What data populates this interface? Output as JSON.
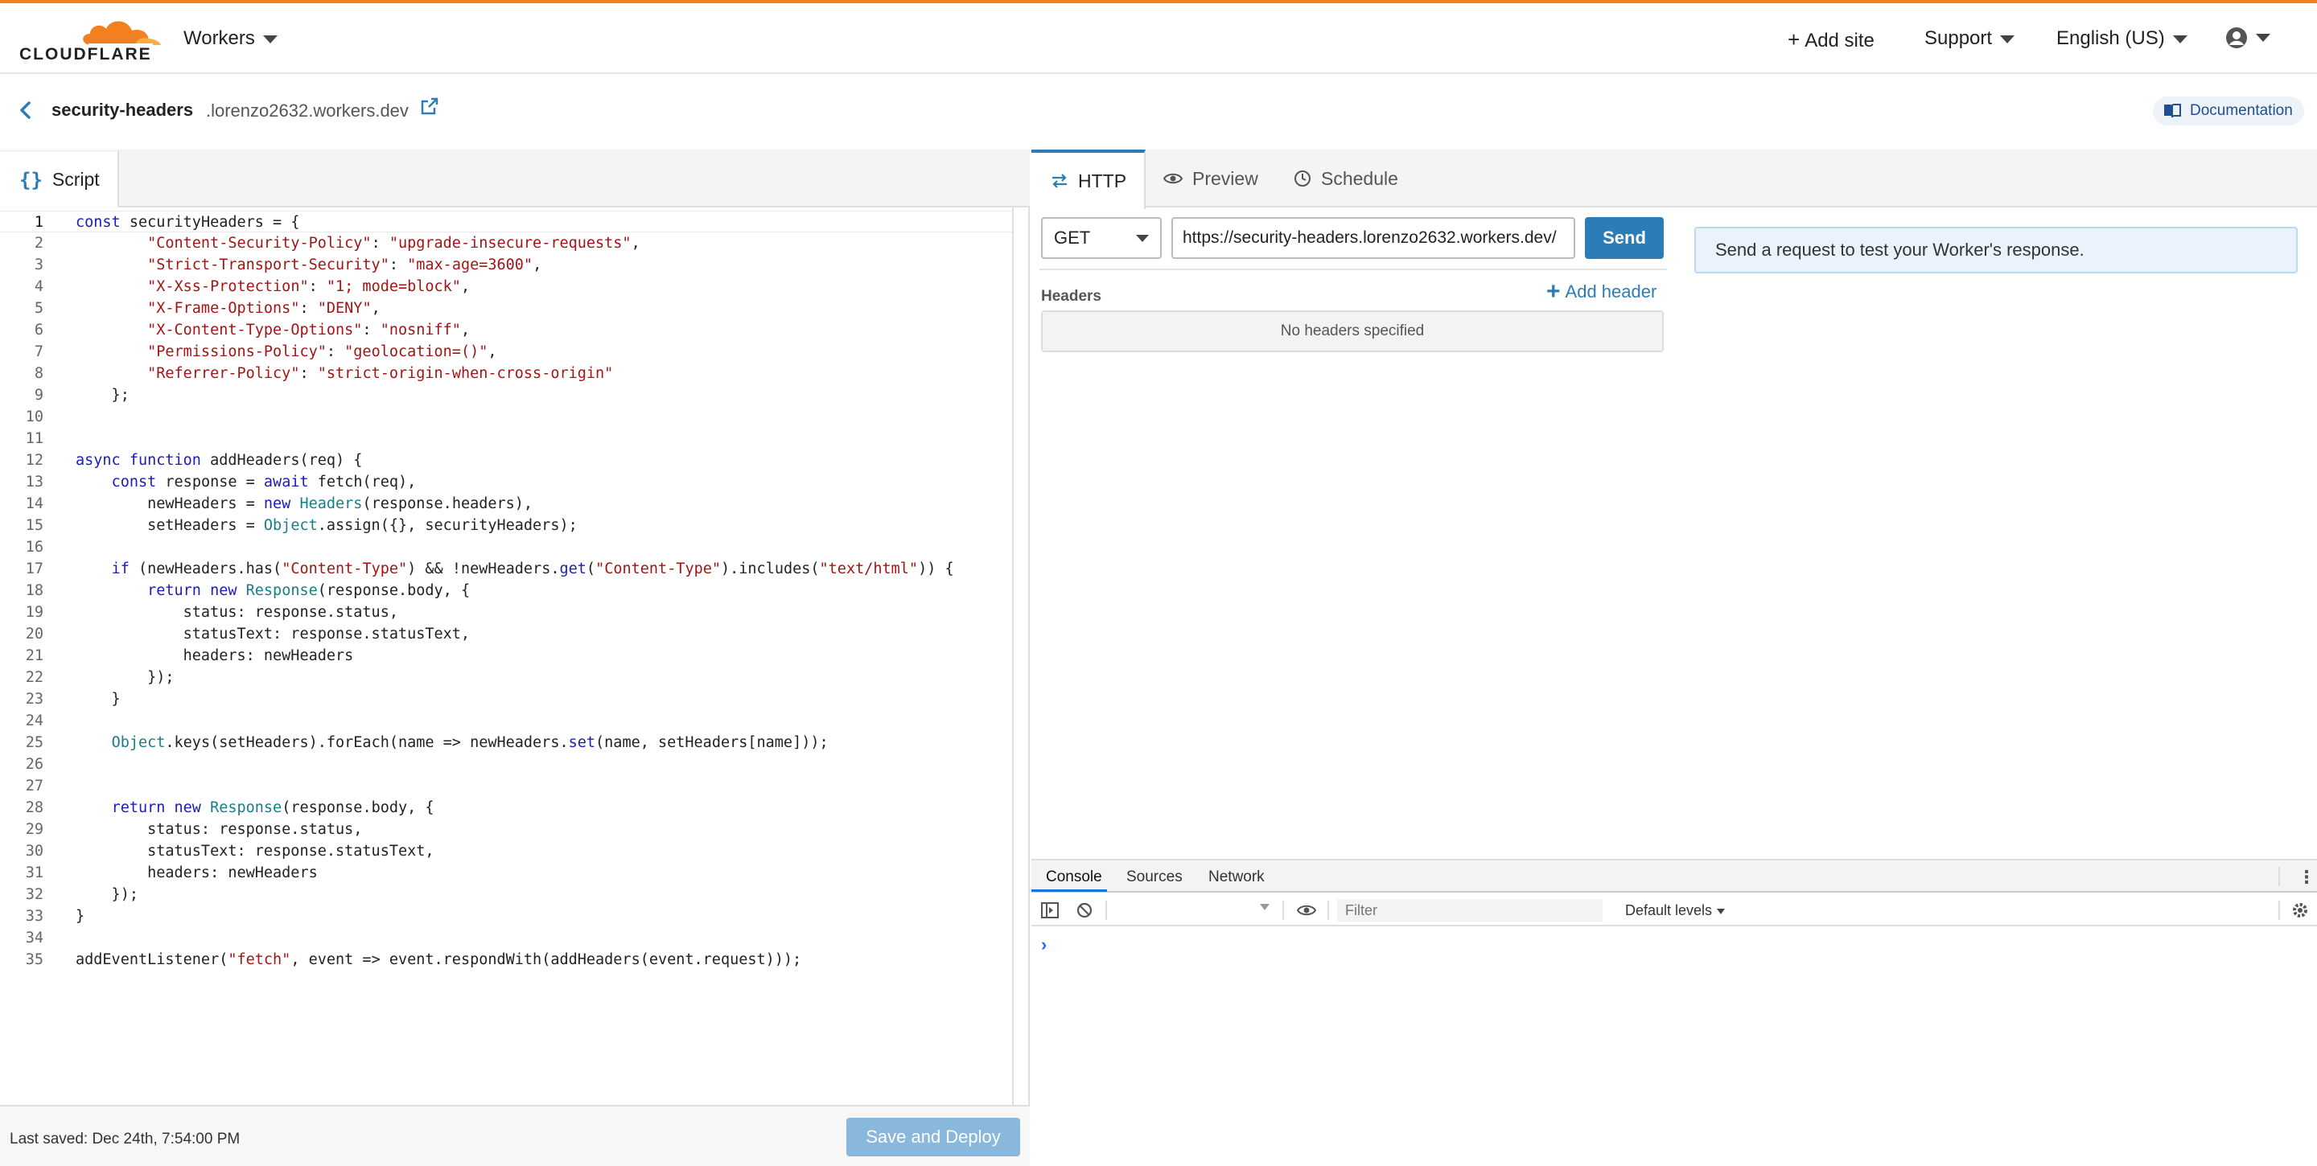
{
  "brand": {
    "name": "CLOUDFLARE",
    "accent": "#f38020",
    "primary": "#2c7cb8"
  },
  "nav": {
    "product": "Workers",
    "add_site": "Add site",
    "support": "Support",
    "language": "English (US)"
  },
  "worker": {
    "name": "security-headers",
    "domain": ".lorenzo2632.workers.dev",
    "documentation": "Documentation"
  },
  "editor": {
    "tab_label": "Script",
    "lines": [
      "const securityHeaders = {",
      "        \"Content-Security-Policy\": \"upgrade-insecure-requests\",",
      "        \"Strict-Transport-Security\": \"max-age=3600\",",
      "        \"X-Xss-Protection\": \"1; mode=block\",",
      "        \"X-Frame-Options\": \"DENY\",",
      "        \"X-Content-Type-Options\": \"nosniff\",",
      "        \"Permissions-Policy\": \"geolocation=()\",",
      "        \"Referrer-Policy\": \"strict-origin-when-cross-origin\"",
      "    };",
      "",
      "",
      "async function addHeaders(req) {",
      "    const response = await fetch(req),",
      "        newHeaders = new Headers(response.headers),",
      "        setHeaders = Object.assign({}, securityHeaders);",
      "",
      "    if (newHeaders.has(\"Content-Type\") && !newHeaders.get(\"Content-Type\").includes(\"text/html\")) {",
      "        return new Response(response.body, {",
      "            status: response.status,",
      "            statusText: response.statusText,",
      "            headers: newHeaders",
      "        });",
      "    }",
      "",
      "    Object.keys(setHeaders).forEach(name => newHeaders.set(name, setHeaders[name]));",
      "",
      "",
      "    return new Response(response.body, {",
      "        status: response.status,",
      "        statusText: response.statusText,",
      "        headers: newHeaders",
      "    });",
      "}",
      "",
      "addEventListener(\"fetch\", event => event.respondWith(addHeaders(event.request)));"
    ],
    "last_saved": "Last saved: Dec 24th, 7:54:00 PM",
    "save_button": "Save and Deploy"
  },
  "request": {
    "tabs": [
      "HTTP",
      "Preview",
      "Schedule"
    ],
    "method": "GET",
    "url": "https://security-headers.lorenzo2632.workers.dev/",
    "send": "Send",
    "headers_label": "Headers",
    "add_header": "Add header",
    "no_headers": "No headers specified",
    "info": "Send a request to test your Worker's response."
  },
  "devtools": {
    "tabs": [
      "Console",
      "Sources",
      "Network"
    ],
    "filter_placeholder": "Filter",
    "levels": "Default levels",
    "prompt": "›"
  }
}
